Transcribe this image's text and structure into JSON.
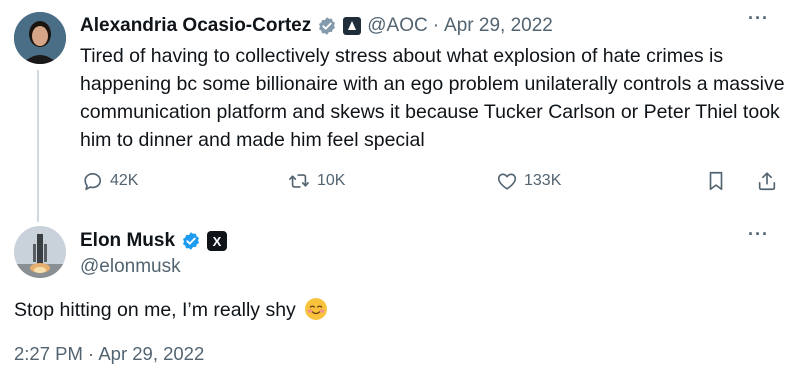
{
  "reply_tweet": {
    "author_name": "Alexandria Ocasio-Cortez",
    "handle": "@AOC",
    "separator": "·",
    "date": "Apr 29, 2022",
    "more_icon": "more-horizontal-icon",
    "text": "Tired of having to collectively stress about what explosion of hate crimes is happening bc some billionaire with an ego problem unilaterally controls a massive communication platform and skews it because Tucker Carlson or Peter Thiel took him to dinner and made him feel special",
    "actions": {
      "replies": "42K",
      "retweets": "10K",
      "likes": "133K"
    },
    "verified_badge_color": "#829aab"
  },
  "main_tweet": {
    "author_name": "Elon Musk",
    "handle": "@elonmusk",
    "affiliate_label": "X",
    "text": "Stop hitting on me, I’m really shy",
    "emoji": "☺",
    "timestamp": "2:27 PM · Apr 29, 2022",
    "verified_badge_color": "#1d9bf0"
  },
  "colors": {
    "text_primary": "#0f1419",
    "text_secondary": "#536471",
    "thread_line": "#cfd9de"
  }
}
